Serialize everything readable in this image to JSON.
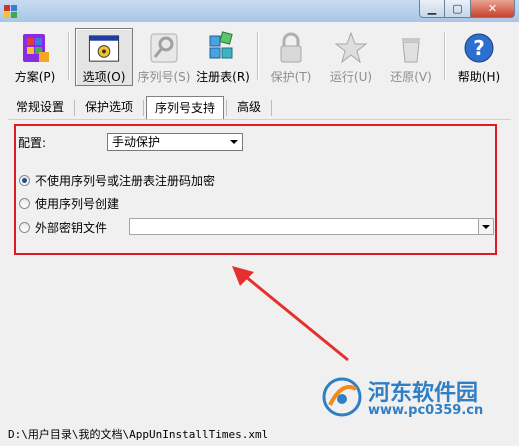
{
  "toolbar": {
    "plan": "方案(P)",
    "options": "选项(O)",
    "serial": "序列号(S)",
    "registry": "注册表(R)",
    "protect": "保护(T)",
    "run": "运行(U)",
    "restore": "还原(V)",
    "help": "帮助(H)"
  },
  "tabs": [
    "常规设置",
    "保护选项",
    "序列号支持",
    "高级"
  ],
  "panel": {
    "config_label": "配置:",
    "config_value": "手动保护",
    "radio1": "不使用序列号或注册表注册码加密",
    "radio2": "使用序列号创建",
    "radio3": "外部密钥文件"
  },
  "status": "D:\\用户目录\\我的文档\\AppUnInstallTimes.xml",
  "watermark": {
    "name": "河东软件园",
    "url": "www.pc0359.cn"
  },
  "colors": {
    "highlight": "#e01a22",
    "arrow": "#e53030",
    "brand": "#2f7fc4"
  }
}
